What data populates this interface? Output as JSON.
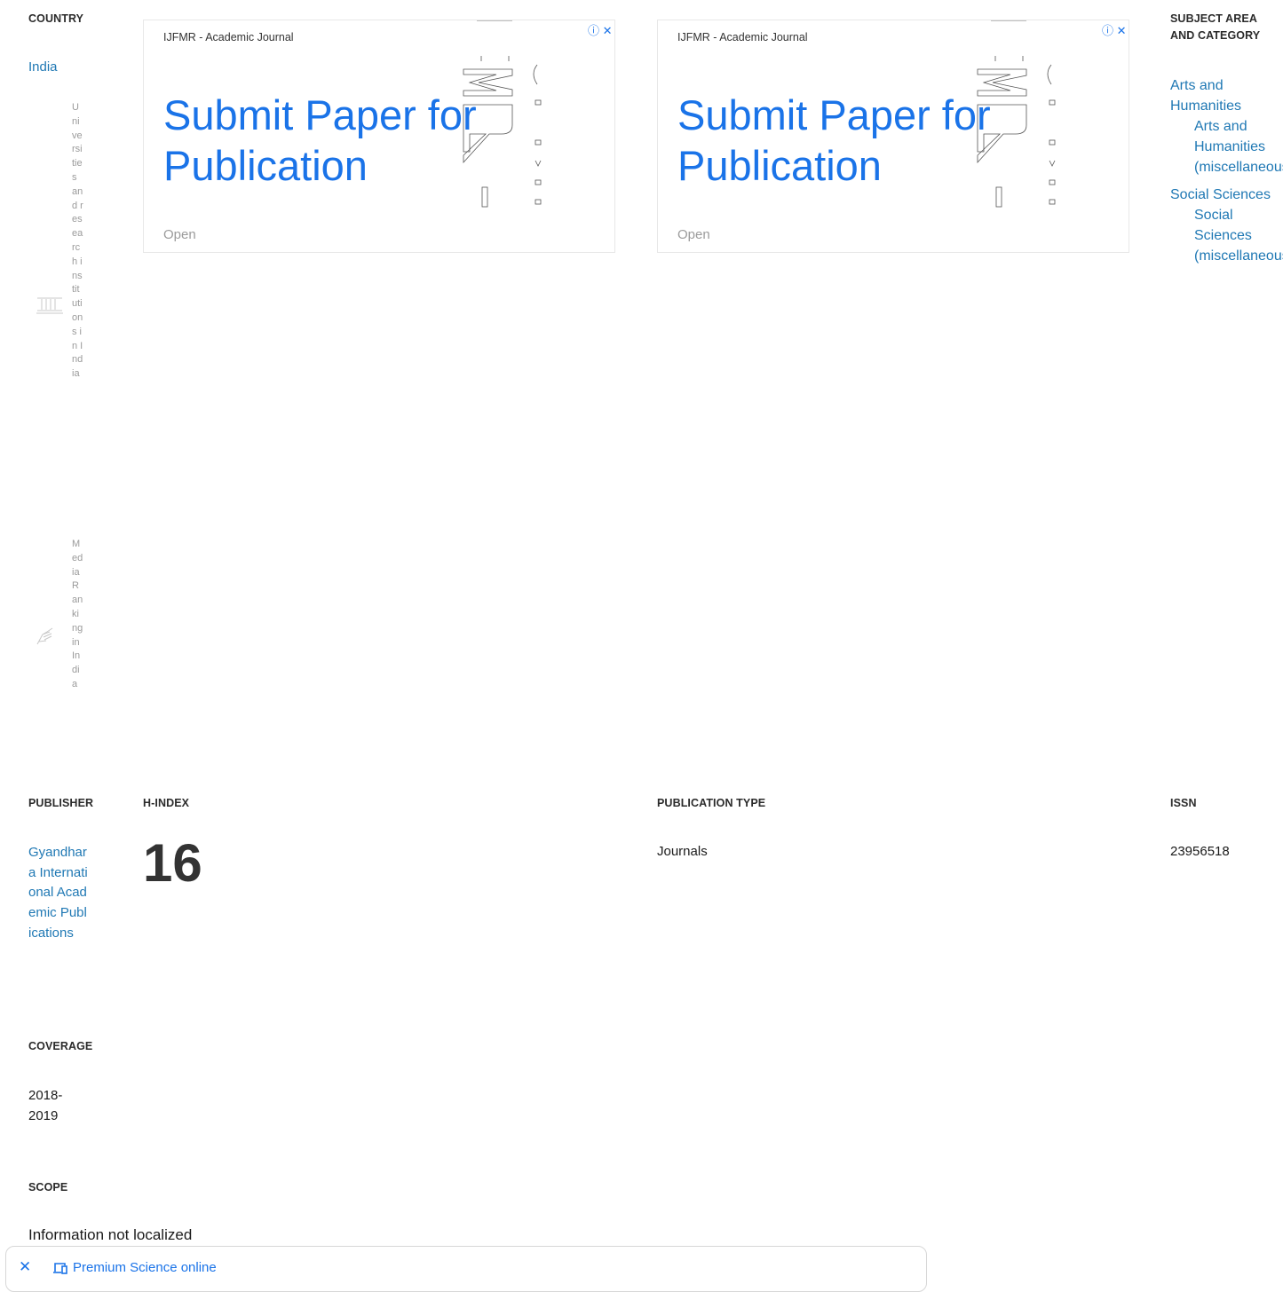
{
  "country": {
    "header": "COUNTRY",
    "name": "India"
  },
  "rankings": [
    {
      "icon": "institution-icon",
      "text": "Universities and research institutions in India"
    },
    {
      "icon": "media-hand-icon",
      "text": "Media Ranking in India"
    }
  ],
  "ads": [
    {
      "brand": "IJFMR - Academic Journal",
      "headline": "Submit Paper for Publication",
      "cta": "Open",
      "adchoices_info": "ⓘ",
      "adchoices_close": "✕"
    },
    {
      "brand": "IJFMR - Academic Journal",
      "headline": "Submit Paper for Publication",
      "cta": "Open",
      "adchoices_info": "ⓘ",
      "adchoices_close": "✕"
    }
  ],
  "subject": {
    "header": "SUBJECT AREA AND CATEGORY",
    "areas": [
      {
        "name": "Arts and Humanities",
        "category": "Arts and Humanities (miscellaneous)"
      },
      {
        "name": "Social Sciences",
        "category": "Social Sciences (miscellaneous)"
      }
    ]
  },
  "publisher": {
    "header": "PUBLISHER",
    "name": "Gyandhara International Academic Publications"
  },
  "hindex": {
    "header": "H-INDEX",
    "value": "16"
  },
  "pubtype": {
    "header": "PUBLICATION TYPE",
    "value": "Journals"
  },
  "issn": {
    "header": "ISSN",
    "value": "23956518"
  },
  "coverage": {
    "header": "COVERAGE",
    "value": "2018-2019"
  },
  "scope": {
    "header": "SCOPE",
    "value": "Information not localized"
  },
  "bottom_ad": {
    "close": "✕",
    "icon": "devices-icon",
    "text": "Premium Science online"
  }
}
